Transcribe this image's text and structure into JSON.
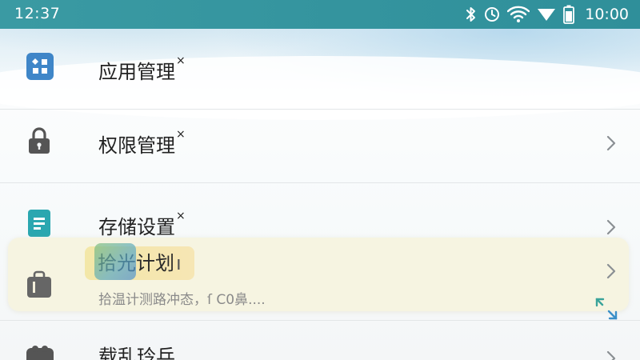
{
  "status_bar": {
    "time_left": "12:37",
    "time_right": "10:00",
    "icons": [
      "bluetooth-icon",
      "alarm-icon",
      "wifi-icon",
      "signal-icon",
      "battery-icon"
    ]
  },
  "colors": {
    "status_bar": "#3194a0",
    "accent_blue": "#3f86c8",
    "accent_teal": "#2aa7b0",
    "icon_gray": "#555555"
  },
  "menu": {
    "items": [
      {
        "label": "应用管理",
        "mark": "×",
        "icon": "app-grid-icon"
      },
      {
        "label": "权限管理",
        "mark": "×",
        "icon": "lock-icon"
      },
      {
        "label": "存储设置",
        "mark": "×",
        "icon": "storage-icon"
      },
      {
        "label": "拾光计划",
        "mark": "ı",
        "subtitle": "拾温计测路冲态，ſ C0鼻....",
        "icon": "bag-icon"
      },
      {
        "label": "载乱玲乒",
        "icon": "puzzle-icon"
      }
    ]
  }
}
